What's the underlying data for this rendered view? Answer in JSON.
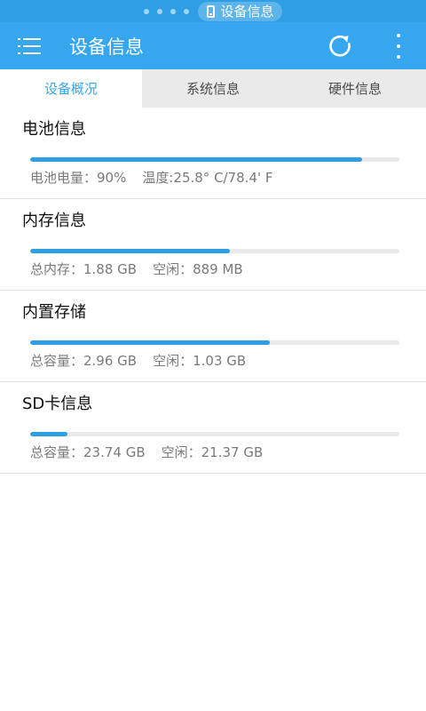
{
  "status_bar": {
    "title": "设备信息",
    "page_dots": 4
  },
  "app_bar": {
    "title": "设备信息",
    "icons": [
      "menu-icon",
      "refresh-icon",
      "more-vert-icon"
    ]
  },
  "tabs": [
    {
      "label": "设备概况",
      "active": true
    },
    {
      "label": "系统信息",
      "active": false
    },
    {
      "label": "硬件信息",
      "active": false
    }
  ],
  "cards": [
    {
      "title": "电池信息",
      "progress": 0.9,
      "detail_left": "电池电量：90%",
      "detail_right": "温度:25.8° C/78.4' F"
    },
    {
      "title": "内存信息",
      "progress": 0.54,
      "detail_left": "总内存：1.88 GB",
      "detail_right": "空闲：889 MB"
    },
    {
      "title": "内置存储",
      "progress": 0.65,
      "detail_left": "总容量：2.96 GB",
      "detail_right": "空闲：1.03 GB"
    },
    {
      "title": "SD卡信息",
      "progress": 0.1,
      "detail_left": "总容量：23.74 GB",
      "detail_right": "空闲：21.37 GB"
    }
  ],
  "colors": {
    "accent": "#36a7ee",
    "status_bar": "#2f9fe5",
    "progress_fill": "#2f9fe5",
    "progress_track": "#e9e9e9",
    "tab_inactive_bg": "#eaeaea"
  }
}
